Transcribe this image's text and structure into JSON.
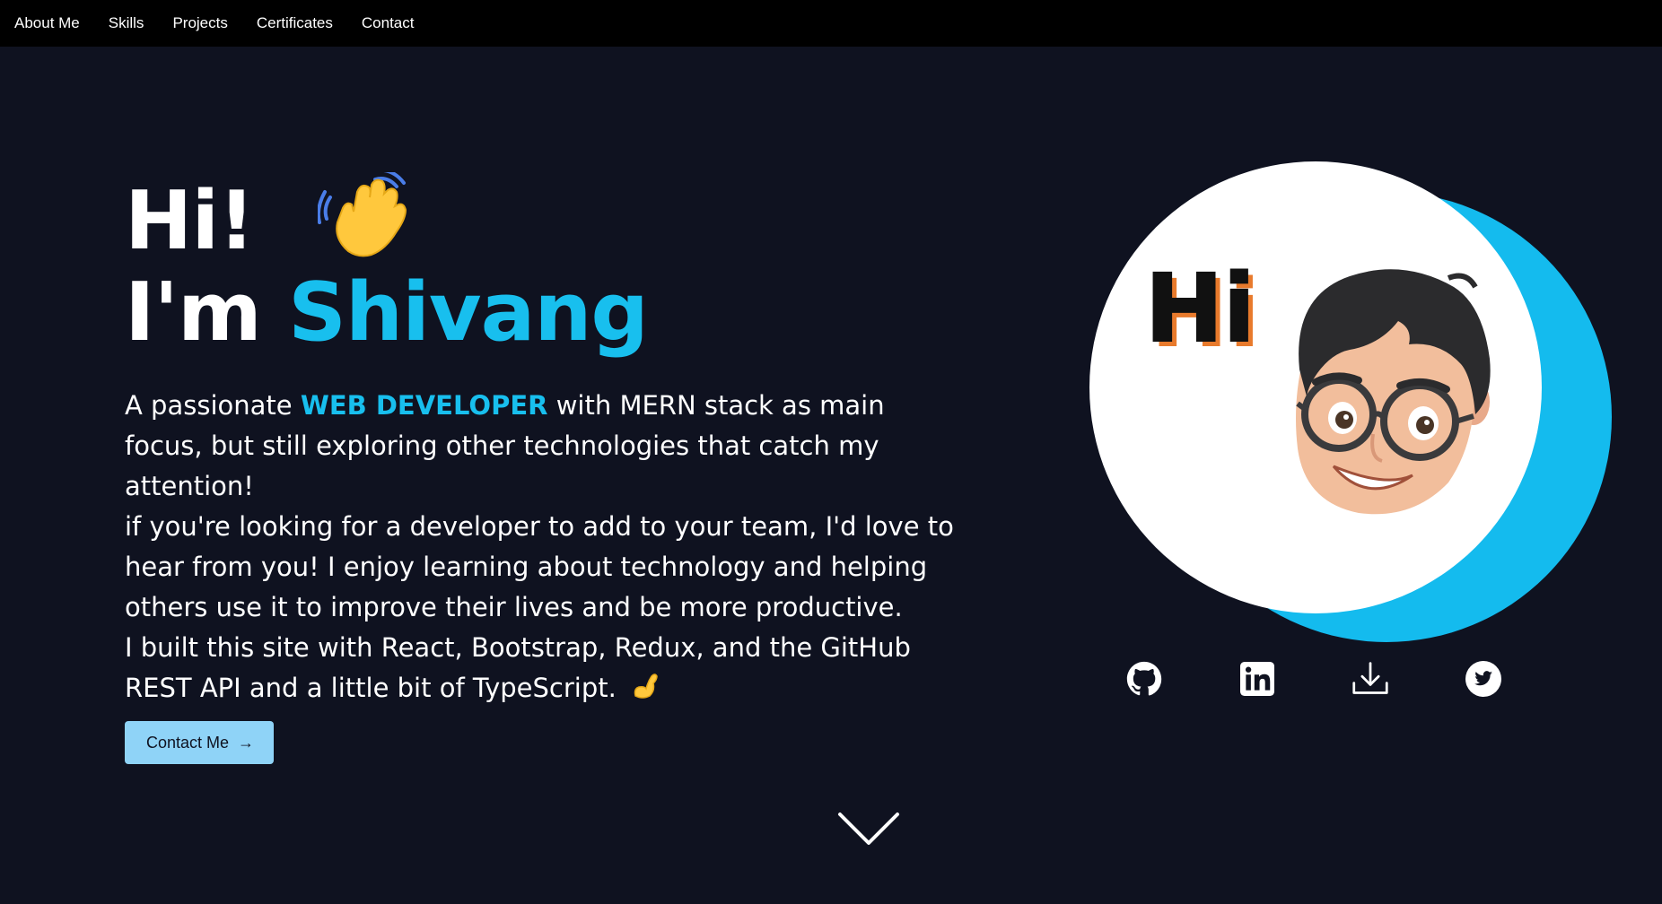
{
  "nav": {
    "items": [
      {
        "label": "About Me"
      },
      {
        "label": "Skills"
      },
      {
        "label": "Projects"
      },
      {
        "label": "Certificates"
      },
      {
        "label": "Contact"
      }
    ]
  },
  "hero": {
    "greeting_line1": "Hi!",
    "greeting_prefix": "I'm",
    "name": "Shivang",
    "bio": {
      "intro_before": "A passionate",
      "intro_highlight": "WEB DEVELOPER",
      "intro_after": "with MERN stack as main focus, but still exploring other technologies that catch my attention!",
      "paragraph2": "if you're looking for a developer to add to your team, I'd love to hear from you! I enjoy learning about technology and helping others use it to improve their lives and be more productive.",
      "paragraph3": "I built this site with React, Bootstrap, Redux, and the GitHub REST API and a little bit of TypeScript."
    },
    "contact_button": {
      "label": "Contact Me",
      "arrow": "→"
    }
  },
  "avatar": {
    "hi_text": "Hi"
  },
  "social": [
    {
      "icon": "github-icon"
    },
    {
      "icon": "linkedin-icon"
    },
    {
      "icon": "download-icon"
    },
    {
      "icon": "twitter-icon"
    }
  ],
  "colors": {
    "background": "#0f1220",
    "nav_background": "#000000",
    "accent": "#18bfee",
    "button_background": "#8fd3f7",
    "circle_white": "#ffffff"
  }
}
